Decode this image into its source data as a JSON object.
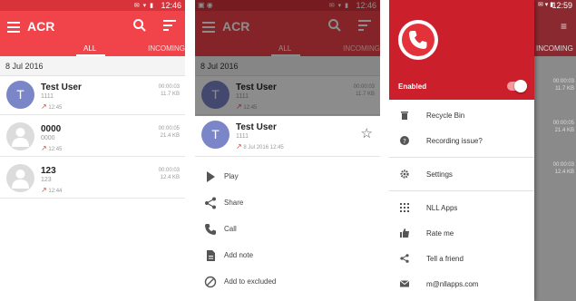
{
  "status": {
    "time1": "12:46",
    "time2": "12:46",
    "time3": "12:59"
  },
  "app": {
    "title": "ACR"
  },
  "tabs": {
    "all": "ALL",
    "incoming": "INCOMING"
  },
  "date_header": "8 Jul 2016",
  "calls": [
    {
      "name": "Test User",
      "number": "1111",
      "time": "12:45",
      "duration": "00:00:03",
      "size": "11.7 KB",
      "avatar": "T"
    },
    {
      "name": "0000",
      "number": "0000",
      "time": "12:45",
      "duration": "00:00:05",
      "size": "21.4 KB",
      "avatar": ""
    },
    {
      "name": "123",
      "number": "123",
      "time": "12:44",
      "duration": "00:00:03",
      "size": "12.4 KB",
      "avatar": ""
    }
  ],
  "sheet": {
    "name": "Test User",
    "number": "1111",
    "datetime": "8 Jul 2016 12:45",
    "avatar": "T",
    "actions": [
      {
        "label": "Play",
        "icon": "play-icon"
      },
      {
        "label": "Share",
        "icon": "share-icon"
      },
      {
        "label": "Call",
        "icon": "call-icon"
      },
      {
        "label": "Add note",
        "icon": "note-icon"
      },
      {
        "label": "Add to excluded",
        "icon": "block-icon"
      }
    ]
  },
  "drawer": {
    "enabled_label": "Enabled",
    "enabled": true,
    "items": [
      {
        "label": "Recycle Bin",
        "icon": "trash-icon"
      },
      {
        "label": "Recording issue?",
        "icon": "help-icon"
      },
      {
        "label": "Settings",
        "icon": "gear-icon"
      },
      {
        "label": "NLL Apps",
        "icon": "apps-icon"
      },
      {
        "label": "Rate me",
        "icon": "thumbs-up-icon"
      },
      {
        "label": "Tell a friend",
        "icon": "share-icon"
      },
      {
        "label": "m@nllapps.com",
        "icon": "email-icon"
      }
    ]
  },
  "colors": {
    "primary": "#f0434a",
    "status": "#d8323a",
    "drawer": "#cc1f2c",
    "accent_arrow": "#e53935",
    "avatar": "#7b86c8"
  }
}
